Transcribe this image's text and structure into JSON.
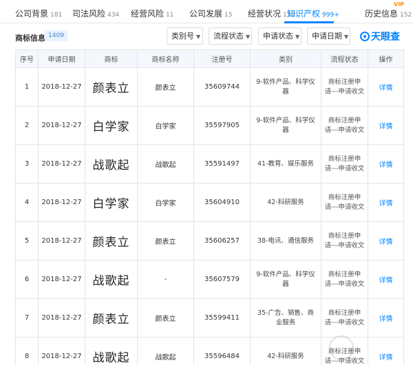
{
  "tabs": [
    {
      "label": "公司背景",
      "count": "181"
    },
    {
      "label": "司法风险",
      "count": "434"
    },
    {
      "label": "经营风险",
      "count": "11"
    },
    {
      "label": "公司发展",
      "count": "15"
    },
    {
      "label": "经营状况",
      "count": "113"
    },
    {
      "label": "知识产权",
      "count": "999+"
    },
    {
      "label": "历史信息",
      "count": "152"
    }
  ],
  "vip_label": "VIP",
  "section": {
    "title": "商标信息",
    "count": "1409"
  },
  "filters": [
    "类别号",
    "流程状态",
    "申请状态",
    "申请日期"
  ],
  "logo_text": "天眼查",
  "columns": [
    "序号",
    "申请日期",
    "商标",
    "商标名称",
    "注册号",
    "类别",
    "流程状态",
    "操作"
  ],
  "rows": [
    {
      "no": "1",
      "date": "2018-12-27",
      "mark": "颜表立",
      "name": "颜表立",
      "reg": "35609744",
      "cat": "9-软件产品、科学仪器",
      "status": "商标注册申请---申请收文",
      "op": "详情"
    },
    {
      "no": "2",
      "date": "2018-12-27",
      "mark": "白学家",
      "name": "白学家",
      "reg": "35597905",
      "cat": "9-软件产品、科学仪器",
      "status": "商标注册申请---申请收文",
      "op": "详情"
    },
    {
      "no": "3",
      "date": "2018-12-27",
      "mark": "战歌起",
      "name": "战歌起",
      "reg": "35591497",
      "cat": "41-教育、娱乐服务",
      "status": "商标注册申请---申请收文",
      "op": "详情"
    },
    {
      "no": "4",
      "date": "2018-12-27",
      "mark": "白学家",
      "name": "白学家",
      "reg": "35604910",
      "cat": "42-科研服务",
      "status": "商标注册申请---申请收文",
      "op": "详情"
    },
    {
      "no": "5",
      "date": "2018-12-27",
      "mark": "颜表立",
      "name": "颜表立",
      "reg": "35606257",
      "cat": "38-电讯、通信服务",
      "status": "商标注册申请---申请收文",
      "op": "详情"
    },
    {
      "no": "6",
      "date": "2018-12-27",
      "mark": "战歌起",
      "name": "-",
      "reg": "35607579",
      "cat": "9-软件产品、科学仪器",
      "status": "商标注册申请---申请收文",
      "op": "详情"
    },
    {
      "no": "7",
      "date": "2018-12-27",
      "mark": "颜表立",
      "name": "颜表立",
      "reg": "35599411",
      "cat": "35-广告、销售、商业服务",
      "status": "商标注册申请---申请收文",
      "op": "详情"
    },
    {
      "no": "8",
      "date": "2018-12-27",
      "mark": "战歌起",
      "name": "战歌起",
      "reg": "35596484",
      "cat": "42-科研服务",
      "status": "商标注册申请---申请收文",
      "op": "详情"
    }
  ],
  "colors": {
    "accent": "#0084ff",
    "header_bg": "#f4f7fb",
    "vip": "#ff8c00"
  }
}
